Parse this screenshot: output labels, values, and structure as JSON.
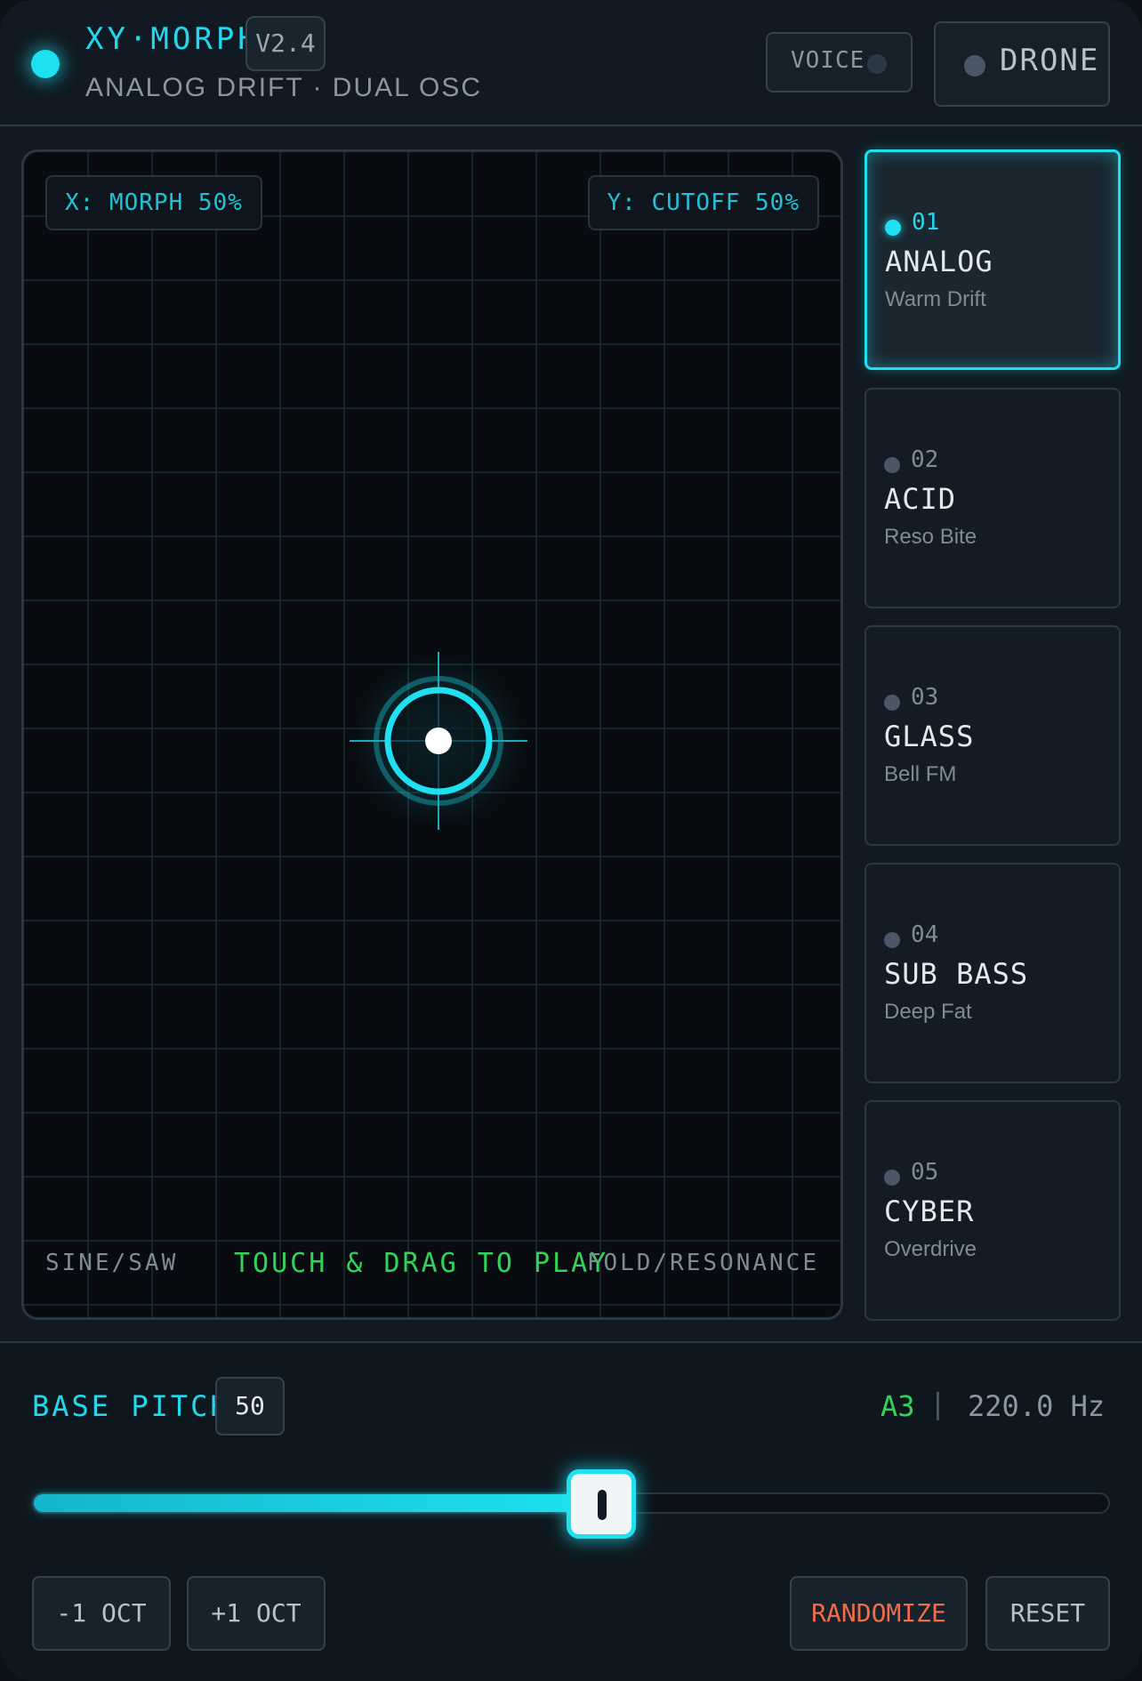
{
  "header": {
    "title": "XY·MORPH",
    "version": "V2.4",
    "subtitle": "ANALOG DRIFT · DUAL OSC",
    "voice_label": "VOICE",
    "drone_label": "DRONE"
  },
  "xy_pad": {
    "x_label": "X: MORPH 50%",
    "y_label": "Y: CUTOFF 50%",
    "x_value": 0.5,
    "y_value": 0.5,
    "footer_left": "SINE/SAW",
    "footer_center": "TOUCH & DRAG TO PLAY",
    "footer_right": "FOLD/RESONANCE"
  },
  "presets": [
    {
      "num": "01",
      "name": "ANALOG",
      "desc": "Warm Drift",
      "active": true
    },
    {
      "num": "02",
      "name": "ACID",
      "desc": "Reso Bite",
      "active": false
    },
    {
      "num": "03",
      "name": "GLASS",
      "desc": "Bell FM",
      "active": false
    },
    {
      "num": "04",
      "name": "SUB BASS",
      "desc": "Deep Fat",
      "active": false
    },
    {
      "num": "05",
      "name": "CYBER",
      "desc": "Overdrive",
      "active": false
    }
  ],
  "pitch": {
    "label": "BASE PITCH",
    "value": "50",
    "note": "A3",
    "separator": "|",
    "frequency": "220.0 Hz",
    "slider_fraction": 0.5
  },
  "buttons": {
    "octave_down": "-1 OCT",
    "octave_up": "+1 OCT",
    "randomize": "RANDOMIZE",
    "reset": "RESET"
  },
  "colors": {
    "accent": "#1ee0f0",
    "green": "#33d35a",
    "warning": "#f26b4a",
    "background": "#111a22"
  }
}
